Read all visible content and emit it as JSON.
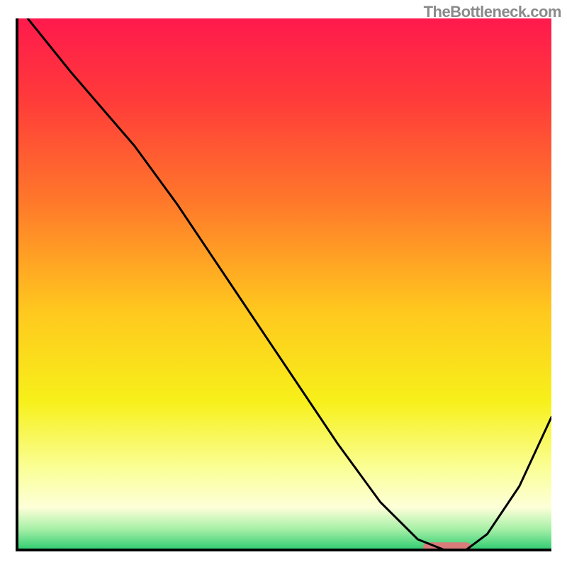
{
  "watermark": "TheBottleneck.com",
  "chart_data": {
    "type": "line",
    "title": "",
    "xlabel": "",
    "ylabel": "",
    "xlim": [
      0,
      1
    ],
    "ylim": [
      0,
      1
    ],
    "series": [
      {
        "name": "curve",
        "x": [
          0.02,
          0.1,
          0.22,
          0.3,
          0.4,
          0.5,
          0.6,
          0.68,
          0.75,
          0.8,
          0.84,
          0.88,
          0.94,
          1.0
        ],
        "values": [
          1.0,
          0.9,
          0.76,
          0.65,
          0.5,
          0.35,
          0.2,
          0.09,
          0.02,
          0.0,
          0.0,
          0.03,
          0.12,
          0.25
        ]
      }
    ],
    "marker": {
      "name": "optimal-range",
      "x_start": 0.76,
      "x_end": 0.85,
      "y": 0.005,
      "color": "#d97b7b"
    },
    "gradient_stops": [
      {
        "offset": 0.0,
        "color": "#ff1a4d"
      },
      {
        "offset": 0.15,
        "color": "#ff3a3a"
      },
      {
        "offset": 0.35,
        "color": "#ff7a2a"
      },
      {
        "offset": 0.55,
        "color": "#ffc81e"
      },
      {
        "offset": 0.72,
        "color": "#f7f01a"
      },
      {
        "offset": 0.85,
        "color": "#faff9a"
      },
      {
        "offset": 0.92,
        "color": "#fdffd8"
      },
      {
        "offset": 0.96,
        "color": "#a8f0a8"
      },
      {
        "offset": 1.0,
        "color": "#2ecc71"
      }
    ],
    "axes": {
      "color": "#000000",
      "width": 4
    }
  }
}
